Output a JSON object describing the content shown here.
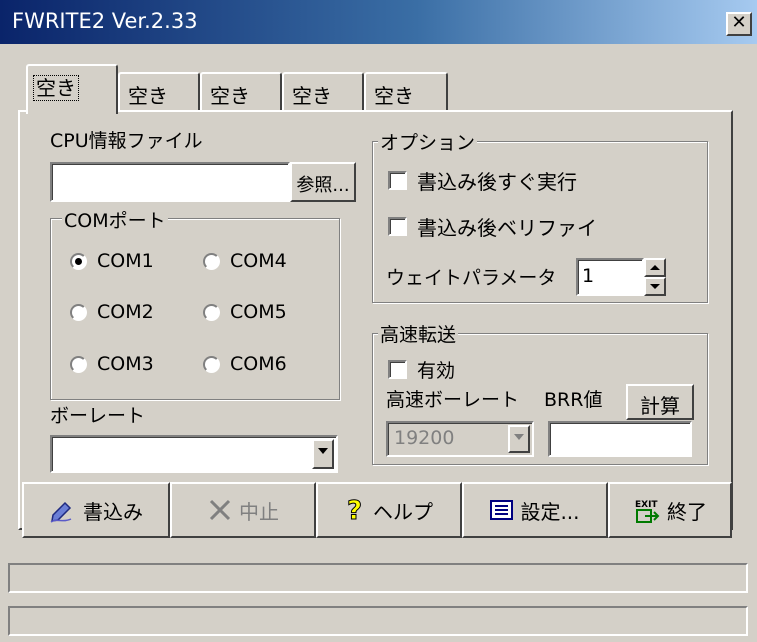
{
  "window": {
    "title": "FWRITE2 Ver.2.33",
    "close_glyph": "✕"
  },
  "tabs": [
    "空き",
    "空き",
    "空き",
    "空き",
    "空き"
  ],
  "cpu_info": {
    "label": "CPU情報ファイル",
    "value": "",
    "browse_label": "参照..."
  },
  "com_port": {
    "label": "COMポート",
    "options": [
      "COM1",
      "COM2",
      "COM3",
      "COM4",
      "COM5",
      "COM6"
    ],
    "selected": "COM1"
  },
  "baud_rate": {
    "label": "ボーレート",
    "value": ""
  },
  "options": {
    "label": "オプション",
    "run_after_write": {
      "label": "書込み後すぐ実行",
      "checked": false
    },
    "verify_after_write": {
      "label": "書込み後ベリファイ",
      "checked": false
    },
    "wait_param": {
      "label": "ウェイトパラメータ",
      "value": "1"
    }
  },
  "high_speed": {
    "label": "高速転送",
    "enable": {
      "label": "有効",
      "checked": false
    },
    "baud_label": "高速ボーレート",
    "brr_label": "BRR値",
    "calc_label": "計算",
    "baud_value": "19200",
    "brr_value": ""
  },
  "buttons": {
    "write": {
      "label": "書込み",
      "icon": "pen-icon"
    },
    "stop": {
      "label": "中止",
      "icon": "x-icon"
    },
    "help": {
      "label": "ヘルプ",
      "icon": "question-icon"
    },
    "settings": {
      "label": "設定...",
      "icon": "list-icon"
    },
    "exit": {
      "label": "終了",
      "icon": "exit-icon",
      "icon_text": "EXIT"
    }
  },
  "status": {
    "line1": "",
    "line2": ""
  }
}
